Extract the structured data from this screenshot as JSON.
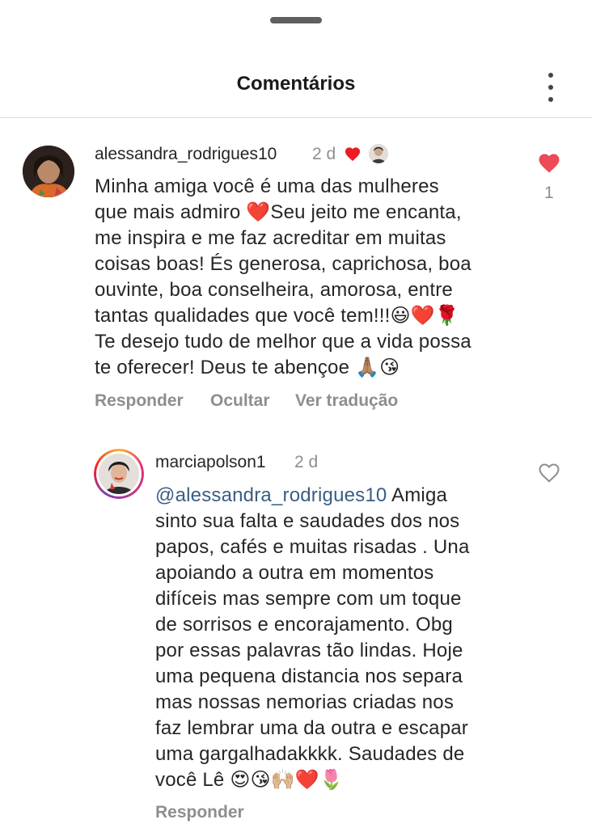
{
  "header": {
    "title": "Comentários"
  },
  "comments": [
    {
      "username": "alessandra_rodrigues10",
      "time": "2 d",
      "likes": "1",
      "body": "Minha amiga você é uma das mulheres\nque mais admiro ❤️Seu  jeito me encanta,\nme inspira e me faz acreditar em muitas\ncoisas boas! És generosa, caprichosa, boa\nouvinte, boa conselheira, amorosa, entre\ntantas qualidades que você tem!!!😃❤️🌹\nTe desejo tudo de melhor que a vida possa\nte oferecer! Deus te abençoe 🙏🏽😘",
      "actions": {
        "reply": "Responder",
        "hide": "Ocultar",
        "translate": "Ver tradução"
      }
    },
    {
      "username": "marciapolson1",
      "time": "2 d",
      "mention": "@alessandra_rodrigues10",
      "body": " Amiga\nsinto sua falta e saudades dos nos\npapos, cafés e muitas risadas . Una\napoiando a outra em momentos\ndifíceis mas sempre com um toque\nde sorrisos e encorajamento.  Obg\npor essas palavras tão lindas. Hoje\numa pequena distancia nos separa\nmas nossas nemorias criadas nos\nfaz lembrar uma da outra e escapar\numa gargalhadakkkk. Saudades de\nvocê Lê 😍😘🙌🏼❤️🌷",
      "actions": {
        "reply": "Responder"
      }
    }
  ],
  "colors": {
    "like_red": "#ed4956",
    "mention_blue": "#3b5d84",
    "meta_gray": "#8e8e8e"
  }
}
